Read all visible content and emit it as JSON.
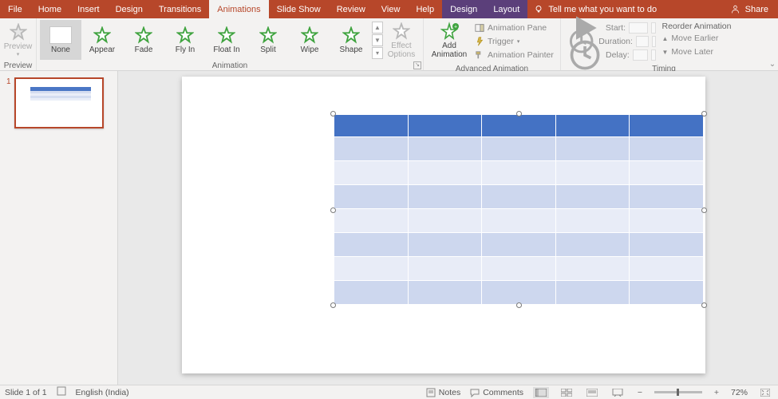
{
  "tabs": {
    "file": "File",
    "home": "Home",
    "insert": "Insert",
    "design": "Design",
    "transitions": "Transitions",
    "animations": "Animations",
    "slideshow": "Slide Show",
    "review": "Review",
    "view": "View",
    "help": "Help",
    "ctx_design": "Design",
    "ctx_layout": "Layout",
    "tell_me": "Tell me what you want to do",
    "share": "Share"
  },
  "ribbon": {
    "preview_group": "Preview",
    "preview": "Preview",
    "animation_group": "Animation",
    "none": "None",
    "appear": "Appear",
    "fade": "Fade",
    "flyin": "Fly In",
    "floatin": "Float In",
    "split": "Split",
    "wipe": "Wipe",
    "shape": "Shape",
    "effect_options": "Effect\nOptions",
    "adv_group": "Advanced Animation",
    "add_animation": "Add\nAnimation",
    "anim_pane": "Animation Pane",
    "trigger": "Trigger",
    "anim_painter": "Animation Painter",
    "timing_group": "Timing",
    "start": "Start:",
    "duration": "Duration:",
    "delay": "Delay:",
    "reorder": "Reorder Animation",
    "move_earlier": "Move Earlier",
    "move_later": "Move Later"
  },
  "thumbs": {
    "n1": "1"
  },
  "status": {
    "slide": "Slide 1 of 1",
    "lang": "English (India)",
    "notes": "Notes",
    "comments": "Comments",
    "zoom": "72%"
  },
  "icons": {
    "up": "▲",
    "down": "▼",
    "more": "▾",
    "caret": "⌄",
    "minus": "−",
    "plus": "+"
  }
}
